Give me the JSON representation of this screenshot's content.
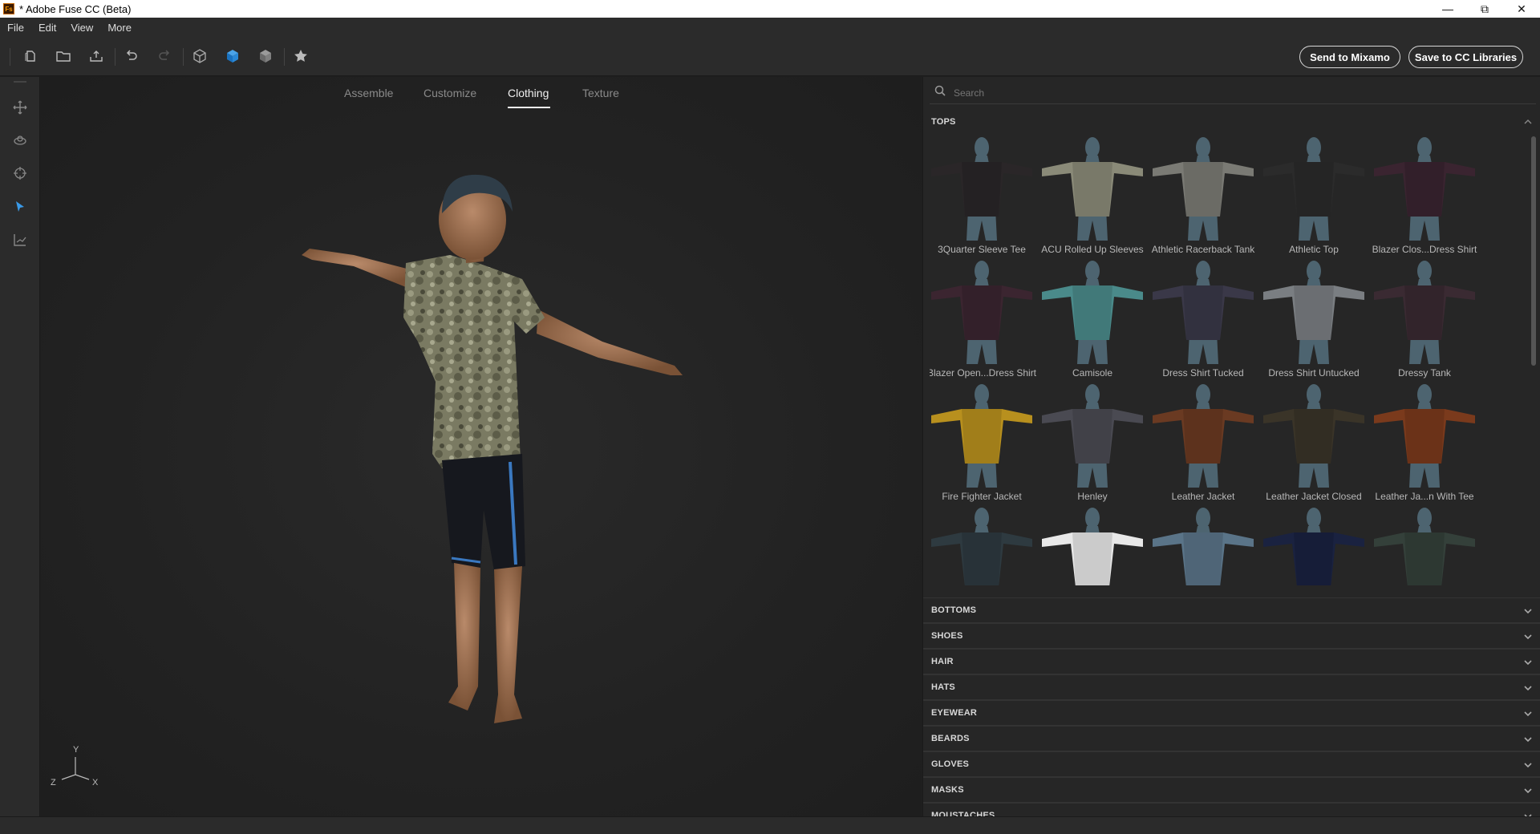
{
  "window": {
    "title": "* Adobe Fuse CC (Beta)",
    "icon_text": "Fs"
  },
  "menu": [
    "File",
    "Edit",
    "View",
    "More"
  ],
  "toolbar": {
    "send_label": "Send to Mixamo",
    "save_label": "Save to CC Libraries"
  },
  "tabs": [
    {
      "label": "Assemble",
      "active": false
    },
    {
      "label": "Customize",
      "active": false
    },
    {
      "label": "Clothing",
      "active": true
    },
    {
      "label": "Texture",
      "active": false
    }
  ],
  "axis": {
    "y": "Y",
    "z": "Z",
    "x": "X"
  },
  "search": {
    "placeholder": "Search",
    "value": ""
  },
  "tops": {
    "title": "TOPS",
    "items": [
      {
        "name": "3Quarter Sleeve Tee",
        "color": "#2a2628"
      },
      {
        "name": "ACU Rolled Up Sleeves",
        "color": "#8a8a78"
      },
      {
        "name": "Athletic Racerback Tank",
        "color": "#7a7a74"
      },
      {
        "name": "Athletic Top",
        "color": "#2b2b2b"
      },
      {
        "name": "Blazer Clos...Dress Shirt",
        "color": "#3a2430"
      },
      {
        "name": "Blazer Open...Dress Shirt",
        "color": "#3b2530"
      },
      {
        "name": "Camisole",
        "color": "#4a8a8a"
      },
      {
        "name": "Dress Shirt Tucked",
        "color": "#3a3848"
      },
      {
        "name": "Dress Shirt Untucked",
        "color": "#7a7e82"
      },
      {
        "name": "Dressy Tank",
        "color": "#3a2a32"
      },
      {
        "name": "Fire Fighter Jacket",
        "color": "#b8901e"
      },
      {
        "name": "Henley",
        "color": "#4a4a52"
      },
      {
        "name": "Leather Jacket",
        "color": "#6a3a22"
      },
      {
        "name": "Leather Jacket Closed",
        "color": "#3a3428"
      },
      {
        "name": "Leather Ja...n With Tee",
        "color": "#7a3a1c"
      },
      {
        "name": "",
        "color": "#2e3a40"
      },
      {
        "name": "",
        "color": "#e8e8e8"
      },
      {
        "name": "",
        "color": "#5a7488"
      },
      {
        "name": "",
        "color": "#1a2240"
      },
      {
        "name": "",
        "color": "#34403a"
      }
    ]
  },
  "sections": [
    "BOTTOMS",
    "SHOES",
    "HAIR",
    "HATS",
    "EYEWEAR",
    "BEARDS",
    "GLOVES",
    "MASKS",
    "MOUSTACHES"
  ]
}
